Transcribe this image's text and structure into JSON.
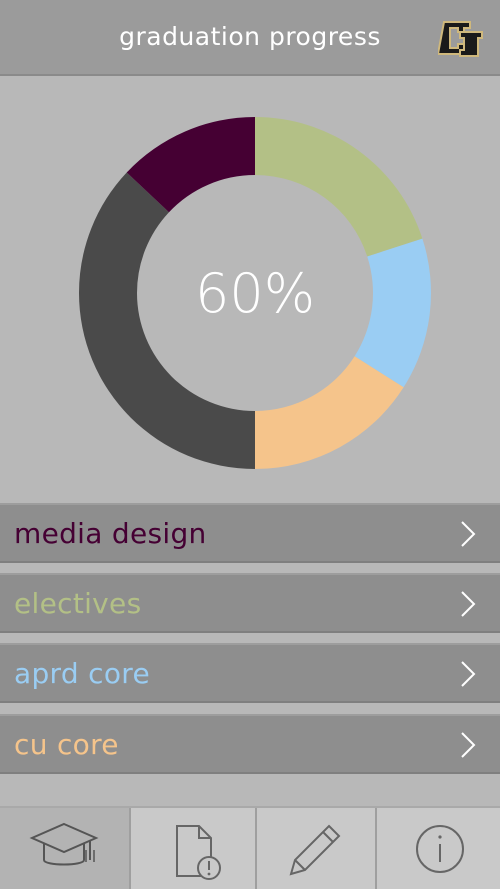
{
  "header": {
    "title": "graduation progress",
    "logo_icon": "cu-logo"
  },
  "chart_data": {
    "type": "pie",
    "center_label": "60%",
    "slices": [
      {
        "value": 20,
        "color": "#b3c086"
      },
      {
        "value": 14,
        "color": "#9acdf3"
      },
      {
        "value": 16,
        "color": "#f5c48b"
      },
      {
        "value": 25,
        "color": "#4a4a4a"
      },
      {
        "value": 12,
        "color": "#4a4a4a"
      },
      {
        "value": 13,
        "color": "#450033"
      }
    ]
  },
  "categories": [
    {
      "label": "media design",
      "color": "#450033"
    },
    {
      "label": "electives",
      "color": "#b3c086"
    },
    {
      "label": "aprd core",
      "color": "#9acdf3"
    },
    {
      "label": "cu core",
      "color": "#f5c48b"
    }
  ],
  "tabs": [
    {
      "icon": "graduation-cap-icon",
      "active": true
    },
    {
      "icon": "document-alert-icon",
      "active": false
    },
    {
      "icon": "pencil-icon",
      "active": false
    },
    {
      "icon": "info-icon",
      "active": false
    }
  ]
}
